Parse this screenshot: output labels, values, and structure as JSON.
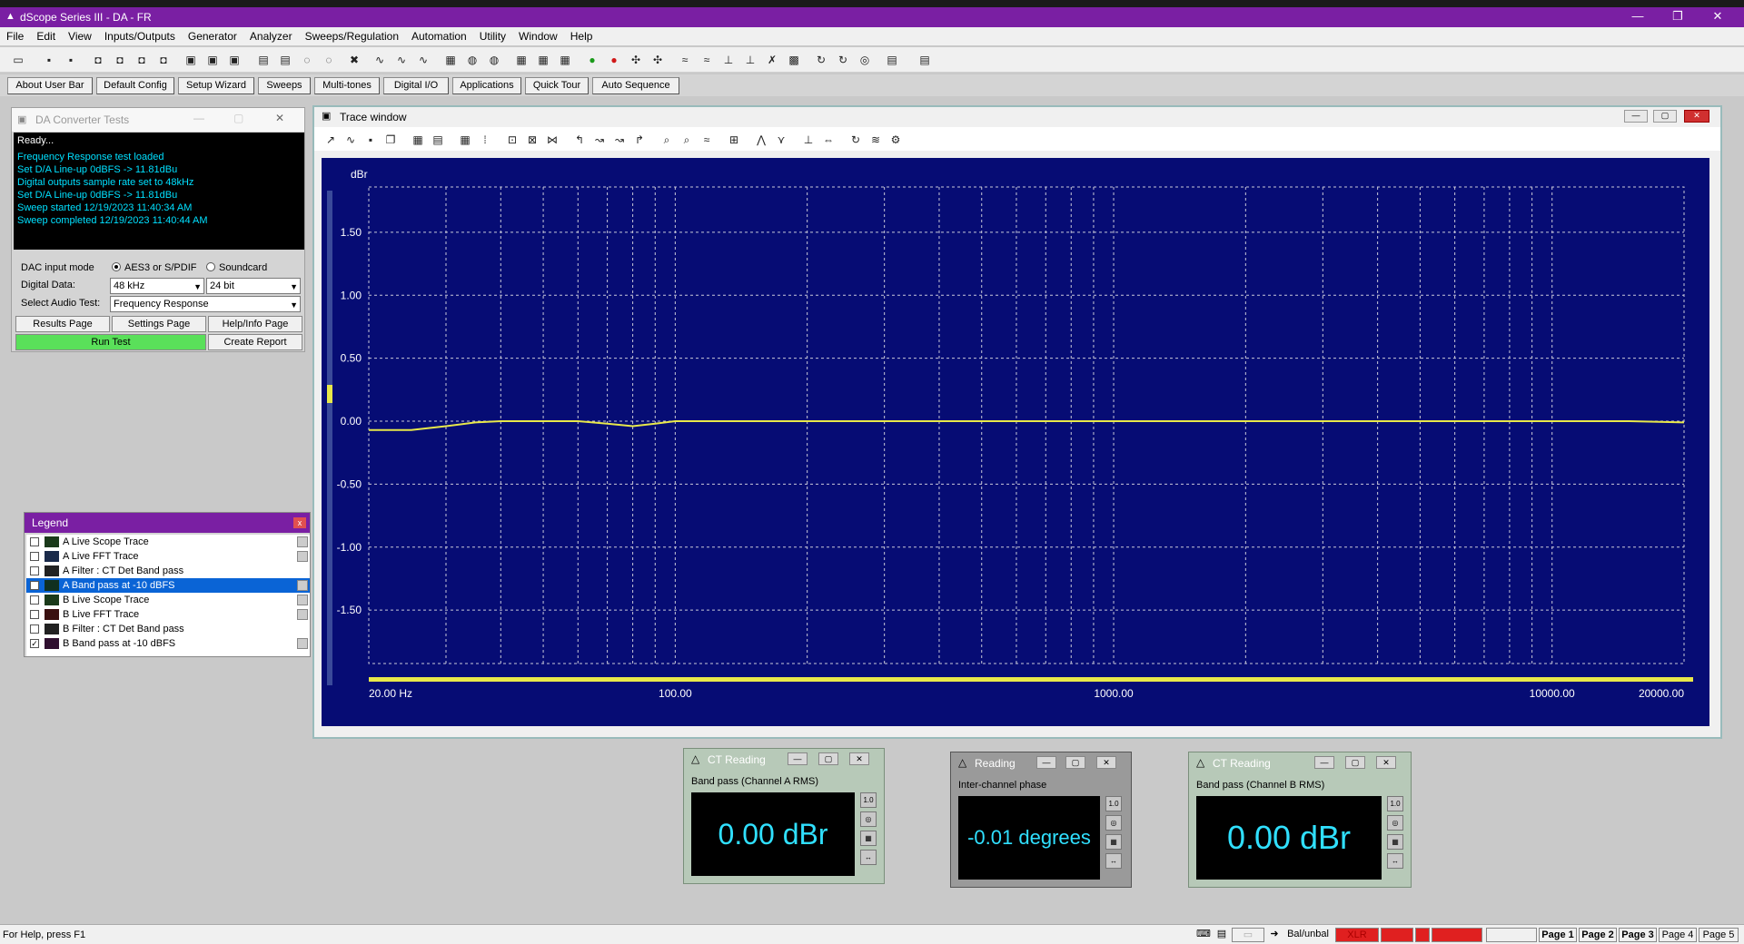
{
  "window": {
    "title": "dScope Series III - DA - FR"
  },
  "menu": [
    "File",
    "Edit",
    "View",
    "Inputs/Outputs",
    "Generator",
    "Analyzer",
    "Sweeps/Regulation",
    "Automation",
    "Utility",
    "Window",
    "Help"
  ],
  "userbar": [
    "About User Bar",
    "Default Config",
    "Setup Wizard",
    "Sweeps",
    "Multi-tones",
    "Digital I/O",
    "Applications",
    "Quick Tour",
    "Auto Sequence"
  ],
  "da_panel": {
    "title": "DA Converter Tests",
    "status": "Ready...",
    "log": [
      "Frequency Response test loaded",
      "Set D/A Line-up 0dBFS -> 11.81dBu",
      "Digital outputs sample rate set to 48kHz",
      "Set D/A Line-up 0dBFS -> 11.81dBu",
      "Sweep started 12/19/2023 11:40:34 AM",
      "Sweep completed 12/19/2023 11:40:44 AM"
    ],
    "input_mode_label": "DAC input mode",
    "input_mode_opt1": "AES3 or S/PDIF",
    "input_mode_opt2": "Soundcard",
    "digital_data_label": "Digital Data:",
    "sample_rate": "48 kHz",
    "bit_depth": "24 bit",
    "audio_test_label": "Select Audio Test:",
    "audio_test": "Frequency Response",
    "btn_results": "Results Page",
    "btn_settings": "Settings Page",
    "btn_help": "Help/Info Page",
    "btn_run": "Run Test",
    "btn_report": "Create Report"
  },
  "legend": {
    "title": "Legend",
    "items": [
      {
        "label": "A  Live Scope Trace",
        "checked": false
      },
      {
        "label": "A  Live FFT Trace",
        "checked": false
      },
      {
        "label": "A  Filter : CT Det Band pass",
        "checked": false
      },
      {
        "label": "A  Band pass  at -10 dBFS",
        "checked": true,
        "selected": true
      },
      {
        "label": "B  Live Scope Trace",
        "checked": false
      },
      {
        "label": "B  Live FFT Trace",
        "checked": false
      },
      {
        "label": "B  Filter : CT Det Band pass",
        "checked": false
      },
      {
        "label": "B  Band pass  at -10 dBFS",
        "checked": true
      }
    ]
  },
  "trace_window": {
    "title": "Trace window"
  },
  "chart_data": {
    "type": "line",
    "ylabel": "dBr",
    "xscale": "log",
    "xlim": [
      20,
      20000
    ],
    "ylim": [
      -1.6,
      1.6
    ],
    "yticks": [
      "1.50",
      "1.00",
      "0.50",
      "0.00",
      "-0.50",
      "-1.00",
      "-1.50"
    ],
    "ytick_values": [
      1.5,
      1.0,
      0.5,
      0.0,
      -0.5,
      -1.0,
      -1.5
    ],
    "xticks": [
      "20.00 Hz",
      "100.00",
      "1000.00",
      "10000.00",
      "20000.00"
    ],
    "xtick_values": [
      20,
      100,
      1000,
      10000,
      20000
    ],
    "grid": true,
    "colors": {
      "background": "#060c74",
      "trace": "#e8e84a",
      "grid": "#c8c8d8",
      "text": "#ffffff"
    },
    "series": [
      {
        "x": [
          20,
          25,
          30,
          35,
          40,
          50,
          60,
          70,
          80,
          90,
          100,
          150,
          200,
          500,
          1000,
          5000,
          10000,
          15000,
          20000
        ],
        "y": [
          -0.07,
          -0.07,
          -0.04,
          -0.01,
          0.0,
          0.0,
          0.0,
          -0.02,
          -0.04,
          -0.02,
          0.0,
          0.0,
          0.0,
          0.0,
          0.0,
          0.0,
          0.0,
          0.0,
          -0.01
        ]
      }
    ]
  },
  "readings": [
    {
      "title": "CT Reading",
      "label": "Band pass (Channel A RMS)",
      "value": "0.00 dBr"
    },
    {
      "title": "Reading",
      "label": "Inter-channel phase",
      "value": "-0.01 degrees"
    },
    {
      "title": "CT Reading",
      "label": "Band pass (Channel B RMS)",
      "value": "0.00 dBr"
    }
  ],
  "status": {
    "help": "For Help, press F1",
    "balunbal": "Bal/unbal",
    "xlr": "XLR",
    "pages": [
      "Page 1",
      "Page 2",
      "Page 3",
      "Page 4",
      "Page 5"
    ]
  }
}
